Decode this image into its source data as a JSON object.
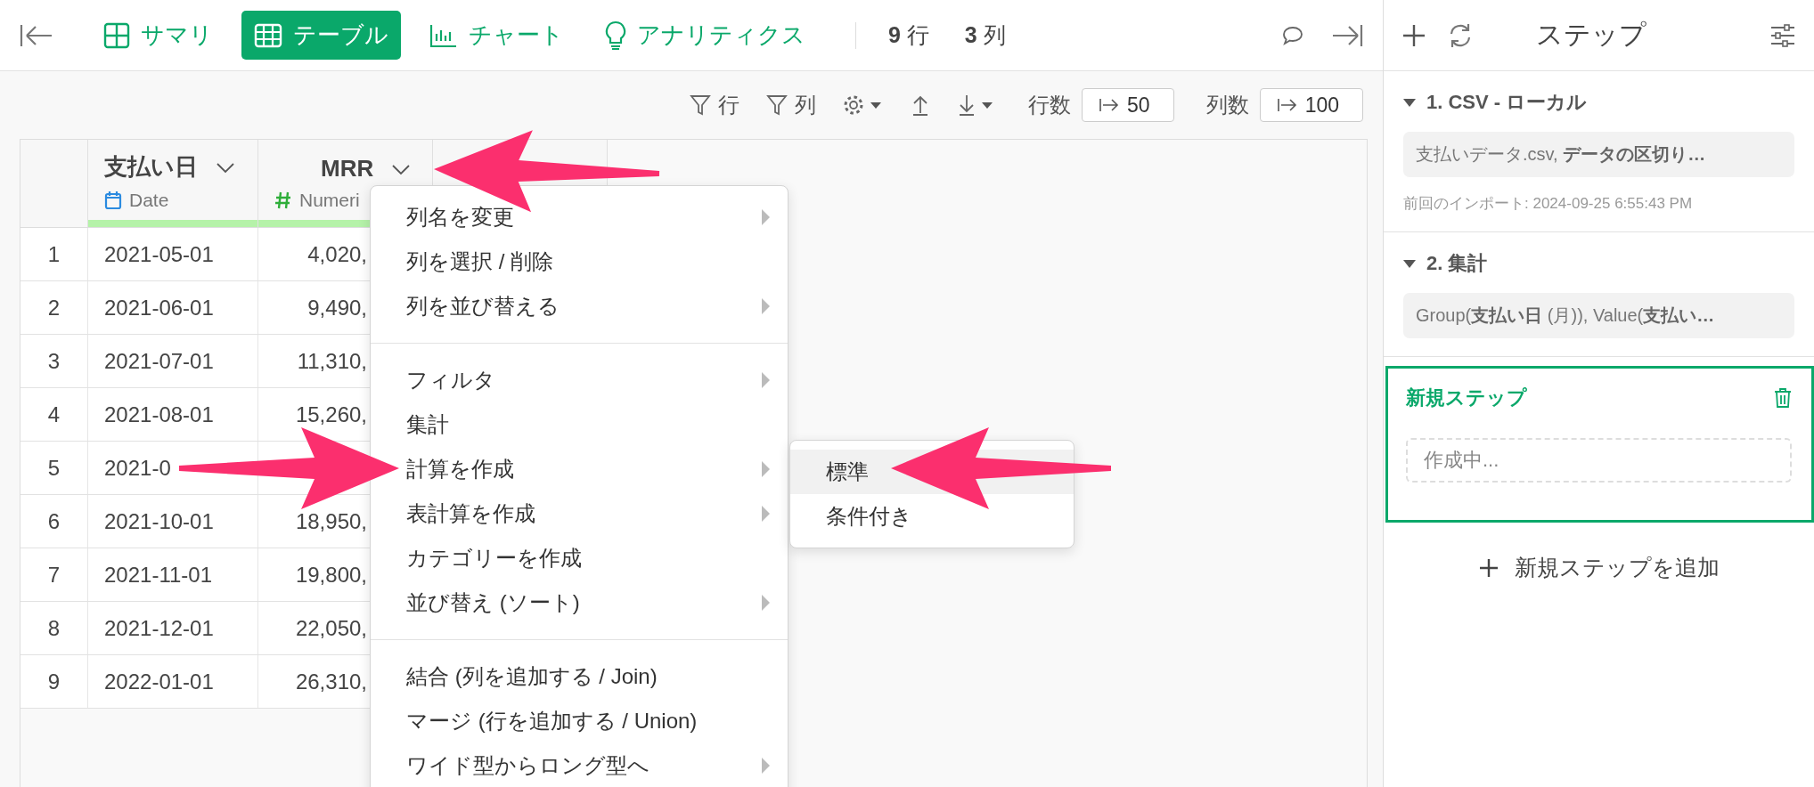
{
  "toolbar": {
    "tabs": [
      {
        "label": "サマリ",
        "kind": "summary",
        "selected": false
      },
      {
        "label": "テーブル",
        "kind": "table",
        "selected": true
      },
      {
        "label": "チャート",
        "kind": "chart",
        "selected": false
      },
      {
        "label": "アナリティクス",
        "kind": "analytics",
        "selected": false
      }
    ],
    "counts": [
      {
        "number": "9",
        "unit": "行"
      },
      {
        "number": "3",
        "unit": "列"
      }
    ]
  },
  "table_tools": {
    "row_filter": "行",
    "column_filter": "列",
    "row_limit": {
      "label": "行数",
      "value": "50"
    },
    "column_limit": {
      "label": "列数",
      "value": "100"
    }
  },
  "table": {
    "columns": [
      {
        "name": "支払い日",
        "type": "Date",
        "kind": "date"
      },
      {
        "name": "MRR",
        "type": "Numeri",
        "kind": "numeric"
      }
    ],
    "rows": [
      {
        "index": "1",
        "cells": [
          "2021-05-01",
          "4,020,"
        ]
      },
      {
        "index": "2",
        "cells": [
          "2021-06-01",
          "9,490,"
        ]
      },
      {
        "index": "3",
        "cells": [
          "2021-07-01",
          "11,310,"
        ]
      },
      {
        "index": "4",
        "cells": [
          "2021-08-01",
          "15,260,"
        ]
      },
      {
        "index": "5",
        "cells": [
          "2021-0"
        ]
      },
      {
        "index": "6",
        "cells": [
          "2021-10-01",
          "18,950,"
        ]
      },
      {
        "index": "7",
        "cells": [
          "2021-11-01",
          "19,800,"
        ]
      },
      {
        "index": "8",
        "cells": [
          "2021-12-01",
          "22,050,"
        ]
      },
      {
        "index": "9",
        "cells": [
          "2022-01-01",
          "26,310,"
        ]
      }
    ]
  },
  "context_menu": {
    "groups": [
      {
        "items": [
          {
            "label": "列名を変更",
            "submenu": true
          },
          {
            "label": "列を選択 / 削除",
            "submenu": false
          },
          {
            "label": "列を並び替える",
            "submenu": true
          }
        ]
      },
      {
        "items": [
          {
            "label": "フィルタ",
            "submenu": true
          },
          {
            "label": "集計",
            "submenu": false
          },
          {
            "label": "計算を作成",
            "submenu": true
          },
          {
            "label": "表計算を作成",
            "submenu": true
          },
          {
            "label": "カテゴリーを作成",
            "submenu": false
          },
          {
            "label": "並び替え (ソート)",
            "submenu": true
          }
        ]
      },
      {
        "items": [
          {
            "label": "結合 (列を追加する / Join)",
            "submenu": false
          },
          {
            "label": "マージ (行を追加する / Union)",
            "submenu": false
          },
          {
            "label": "ワイド型からロング型へ",
            "submenu": true
          }
        ]
      }
    ],
    "submenu": [
      {
        "label": "標準",
        "selected": true
      },
      {
        "label": "条件付き",
        "selected": false
      }
    ]
  },
  "steps_panel": {
    "title": "ステップ",
    "steps": [
      {
        "title": "1. CSV - ローカル",
        "expanded": true,
        "summary": "支払いデータ.csv, **データの区切り…**",
        "note": "前回のインポート: 2024-09-25 6:55:43 PM"
      },
      {
        "title": "2. 集計",
        "expanded": true,
        "summary": "Group(**支払い日** (月)), Value(**支払い…**"
      }
    ],
    "new_step": {
      "title": "新規ステップ",
      "selected": true,
      "placeholder": "作成中..."
    },
    "add_button": "新規ステップを追加"
  }
}
